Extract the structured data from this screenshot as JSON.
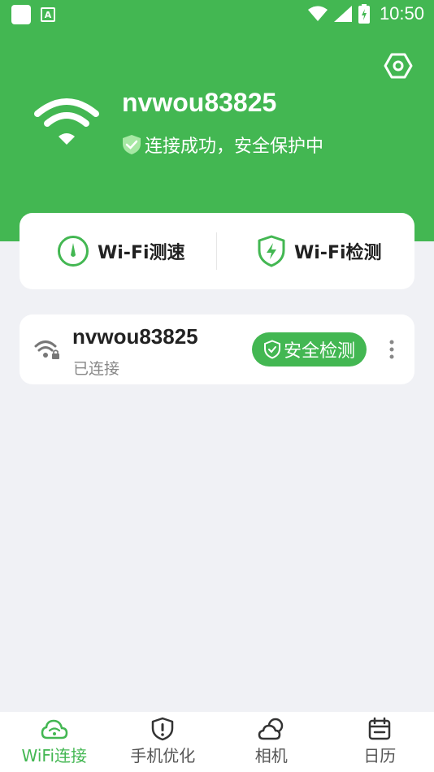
{
  "statusbar": {
    "time": "10:50",
    "a_icon": "A"
  },
  "network": {
    "ssid": "nvwou83825",
    "status_text": "连接成功，安全保护中"
  },
  "tools": [
    {
      "label": "Wi-Fi测速",
      "icon": "speedometer-icon"
    },
    {
      "label": "Wi-Fi检测",
      "icon": "shield-bolt-icon"
    }
  ],
  "network_card": {
    "ssid": "nvwou83825",
    "status": "已连接",
    "check_label": "安全检测"
  },
  "tabs": [
    {
      "label": "WiFi连接",
      "icon": "wifi-cloud-icon",
      "active": true
    },
    {
      "label": "手机优化",
      "icon": "shield-alert-icon",
      "active": false
    },
    {
      "label": "相机",
      "icon": "cloud-sun-icon",
      "active": false
    },
    {
      "label": "日历",
      "icon": "calendar-icon",
      "active": false
    }
  ],
  "colors": {
    "primary": "#43b752",
    "background": "#f0f1f5"
  }
}
